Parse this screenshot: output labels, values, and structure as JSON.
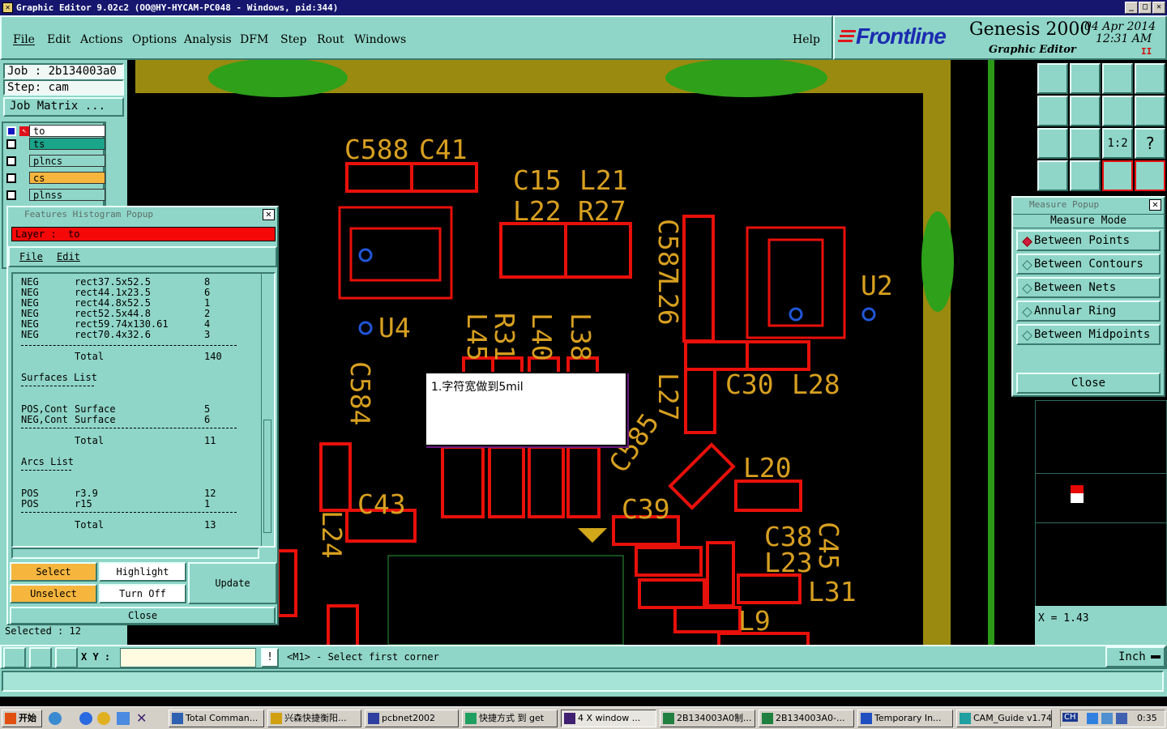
{
  "window": {
    "title": "Graphic Editor 9.02c2 (OO@HY-HYCAM-PC048 - Windows, pid:344)"
  },
  "menu": {
    "file": "File",
    "edit": "Edit",
    "actions": "Actions",
    "options": "Options",
    "analysis": "Analysis",
    "dfm": "DFM",
    "step": "Step",
    "rout": "Rout",
    "windows": "Windows",
    "help": "Help"
  },
  "brand": {
    "logo": "Frontline",
    "product": "Genesis 2000",
    "subtitle": "Graphic Editor",
    "date": "04 Apr 2014",
    "time": "12:31 AM",
    "marker": "II"
  },
  "job": {
    "job_label": "Job : 2b134003a0",
    "step_label": "Step: cam",
    "matrix_button": "Job Matrix ..."
  },
  "layers": [
    {
      "name": "to",
      "color": "#ffffff"
    },
    {
      "name": "ts",
      "color": "#1aa58b"
    },
    {
      "name": "plncs",
      "color": "#8fd6c8"
    },
    {
      "name": "cs",
      "color": "#f6b63e"
    },
    {
      "name": "plnss",
      "color": "#8fd6c8"
    }
  ],
  "histogram": {
    "title": "Features Histogram Popup",
    "layer_label": "Layer :  to",
    "menu_file": "File",
    "menu_edit": "Edit",
    "rows": [
      {
        "pol": "NEG",
        "sym": "rect37.5x52.5",
        "count": "8"
      },
      {
        "pol": "NEG",
        "sym": "rect44.1x23.5",
        "count": "6"
      },
      {
        "pol": "NEG",
        "sym": "rect44.8x52.5",
        "count": "1"
      },
      {
        "pol": "NEG",
        "sym": "rect52.5x44.8",
        "count": "2"
      },
      {
        "pol": "NEG",
        "sym": "rect59.74x130.61",
        "count": "4"
      },
      {
        "pol": "NEG",
        "sym": "rect70.4x32.6",
        "count": "3"
      }
    ],
    "total_label": "Total",
    "total1": "140",
    "surfaces_heading": "Surfaces List",
    "surf_rows": [
      {
        "pol": "POS,Cont",
        "sym": "Surface",
        "count": "5"
      },
      {
        "pol": "NEG,Cont",
        "sym": "Surface",
        "count": "6"
      }
    ],
    "total2": "11",
    "arcs_heading": "Arcs List",
    "arc_rows": [
      {
        "pol": "POS",
        "sym": "r3.9",
        "count": "12"
      },
      {
        "pol": "POS",
        "sym": "r15",
        "count": "1"
      }
    ],
    "total3": "13",
    "btn_select": "Select",
    "btn_highlight": "Highlight",
    "btn_update": "Update",
    "btn_unselect": "Unselect",
    "btn_turnoff": "Turn Off",
    "btn_close": "Close"
  },
  "selected": "Selected : 12",
  "measure": {
    "title": "Measure Popup",
    "heading": "Measure Mode",
    "modes": [
      "Between Points",
      "Between Contours",
      "Between Nets",
      "Annular Ring",
      "Between Midpoints"
    ],
    "selected_mode": 0,
    "close": "Close"
  },
  "x_readout": "X = 1.43",
  "note": "1.字符宽做到5mil",
  "command": {
    "xy_label": "X Y :",
    "xy_value": "",
    "bang": "!",
    "prompt": "<M1> - Select first corner",
    "units": "Inch"
  },
  "canvas_labels": [
    "C588",
    "C41",
    "C15",
    "L21",
    "L22",
    "R27",
    "C587",
    "L26",
    "U2",
    "U4",
    "L45",
    "R31",
    "L40",
    "L38",
    "C584",
    "C30",
    "L28",
    "L27",
    "C585",
    "L20",
    "C43",
    "C39",
    "L24",
    "C38",
    "C45",
    "L23",
    "L31",
    "L9"
  ],
  "taskbar": {
    "start": "开始",
    "tasks": [
      "Total Comman...",
      "兴森快捷衡阳...",
      "pcbnet2002",
      "快捷方式 到 get",
      "4 X window ...",
      "2B134003A0制...",
      "2B134003A0-...",
      "Temporary In...",
      "CAM_Guide v1.74"
    ],
    "tray": "CH",
    "clock": "0:35"
  }
}
